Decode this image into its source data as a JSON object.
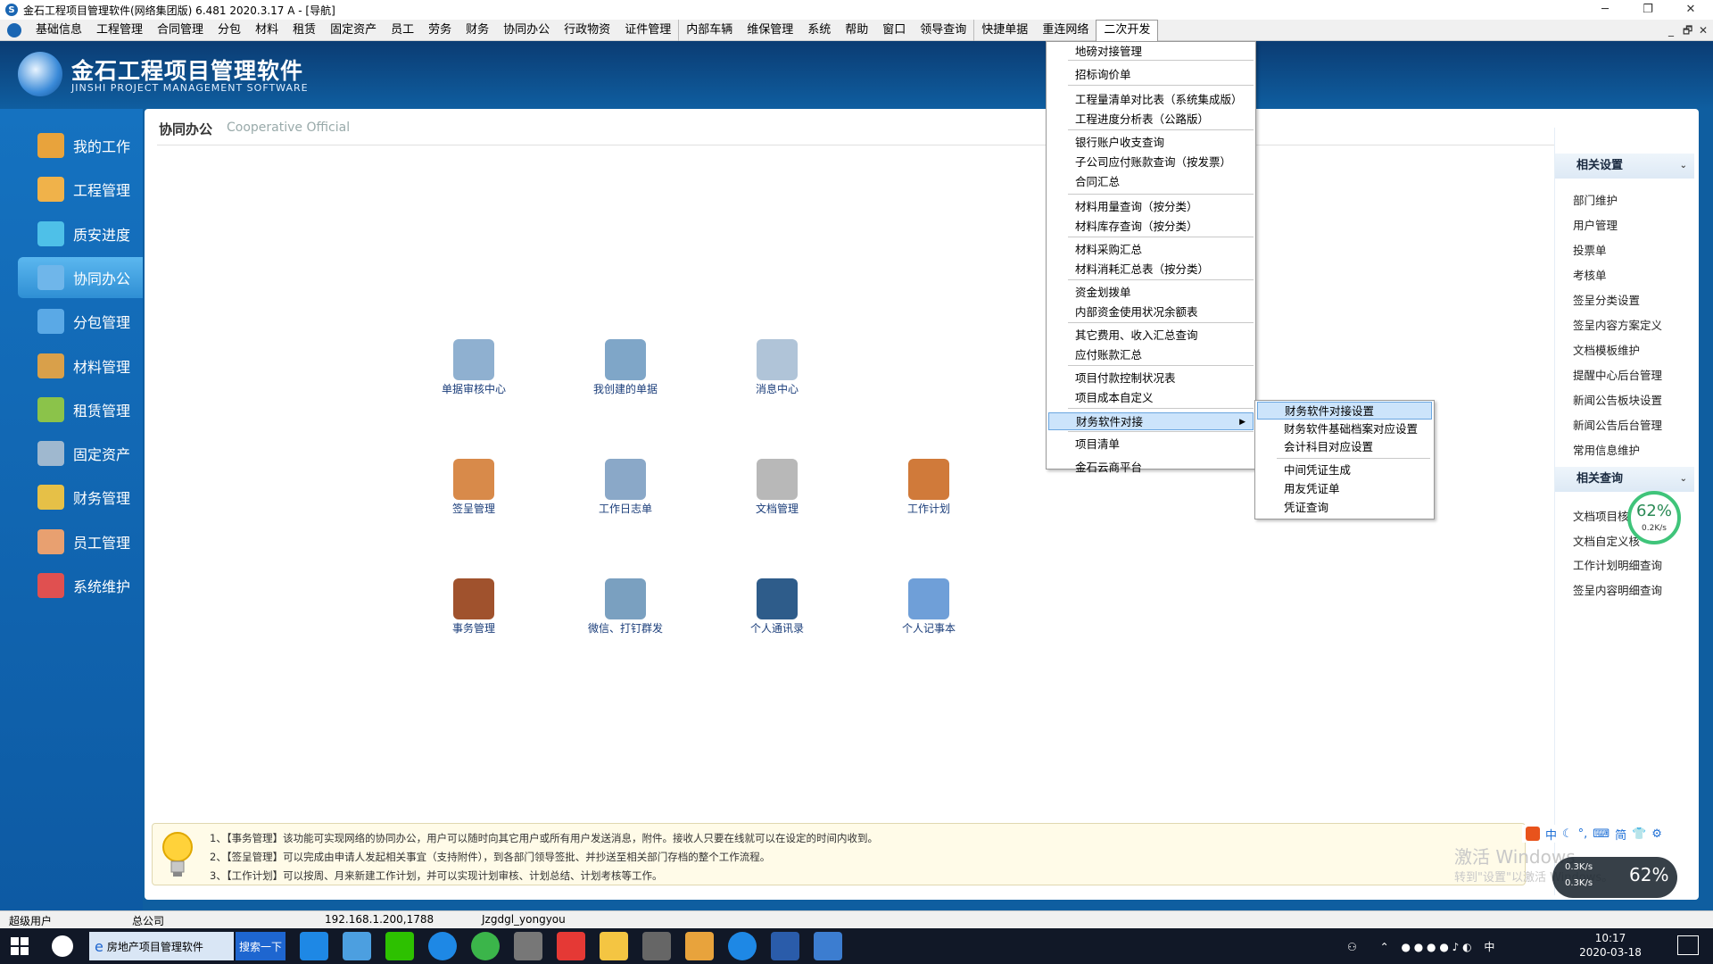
{
  "titlebar": {
    "title": "金石工程项目管理软件(网络集团版) 6.481  2020.3.17 A - [导航]",
    "minimize": "─",
    "restore": "❐",
    "close": "✕"
  },
  "menubar": {
    "items": [
      "基础信息",
      "工程管理",
      "合同管理",
      "分包",
      "材料",
      "租赁",
      "固定资产",
      "员工",
      "劳务",
      "财务",
      "协同办公",
      "行政物资",
      "证件管理",
      "内部车辆",
      "维保管理",
      "系统",
      "帮助",
      "窗口",
      "领导查询",
      "快捷单据",
      "重连网络",
      "二次开发"
    ],
    "mdi_min": "_",
    "mdi_restore": "🗗",
    "mdi_close": "✕"
  },
  "brand": {
    "name_cn": "金石工程项目管理软件",
    "name_en": "JINSHI PROJECT MANAGEMENT SOFTWARE"
  },
  "sidebar": {
    "items": [
      {
        "label": "我的工作",
        "color": "#e8a33c"
      },
      {
        "label": "工程管理",
        "color": "#f0b24a"
      },
      {
        "label": "质安进度",
        "color": "#4ec0e8"
      },
      {
        "label": "协同办公",
        "color": "#6fb6ea"
      },
      {
        "label": "分包管理",
        "color": "#5aa9e6"
      },
      {
        "label": "材料管理",
        "color": "#d9a04a"
      },
      {
        "label": "租赁管理",
        "color": "#8bc34a"
      },
      {
        "label": "固定资产",
        "color": "#9fb8cf"
      },
      {
        "label": "财务管理",
        "color": "#e6c047"
      },
      {
        "label": "员工管理",
        "color": "#e8a070"
      },
      {
        "label": "系统维护",
        "color": "#e05050"
      }
    ]
  },
  "main": {
    "title": "协同办公",
    "subtitle": "Cooperative Official",
    "icons": [
      {
        "label": "单据审核中心",
        "color": "#8fb0d0"
      },
      {
        "label": "我创建的单据",
        "color": "#7fa6c8"
      },
      {
        "label": "消息中心",
        "color": "#b0c4d8"
      },
      {
        "label": "签呈管理",
        "color": "#d88a4a"
      },
      {
        "label": "工作日志单",
        "color": "#8aa8c8"
      },
      {
        "label": "文档管理",
        "color": "#b8b8b8"
      },
      {
        "label": "工作计划",
        "color": "#d07a3a"
      },
      {
        "label": "事务管理",
        "color": "#a0522d"
      },
      {
        "label": "微信、打钉群发",
        "color": "#7aa0c0"
      },
      {
        "label": "个人通讯录",
        "color": "#2e5c8a"
      },
      {
        "label": "个人记事本",
        "color": "#6f9fd8"
      }
    ]
  },
  "right_panel": {
    "settings_title": "相关设置",
    "settings_links": [
      "部门维护",
      "用户管理",
      "投票单",
      "考核单",
      "签呈分类设置",
      "签呈内容方案定义",
      "文档模板维护",
      "提醒中心后台管理",
      "新闻公告板块设置",
      "新闻公告后台管理",
      "常用信息维护"
    ],
    "query_title": "相关查询",
    "query_links": [
      "文档项目核",
      "文档自定义核",
      "工作计划明细查询",
      "签呈内容明细查询"
    ],
    "chevron": "⌄"
  },
  "dropdown": {
    "items": [
      "地磅对接管理",
      "招标询价单",
      "工程量清单对比表（系统集成版）",
      "工程进度分析表（公路版）",
      "银行账户收支查询",
      "子公司应付账款查询（按发票）",
      "合同汇总",
      "材料用量查询（按分类）",
      "材料库存查询（按分类）",
      "材料采购汇总",
      "材料消耗汇总表（按分类）",
      "资金划拨单",
      "内部资金使用状况余额表",
      "其它费用、收入汇总查询",
      "应付账款汇总",
      "项目付款控制状况表",
      "项目成本自定义",
      "财务软件对接",
      "项目清单",
      "金石云商平台"
    ],
    "highlighted": "财务软件对接",
    "arrow": "▶"
  },
  "submenu": {
    "items": [
      "财务软件对接设置",
      "财务软件基础档案对应设置",
      "会计科目对应设置",
      "中间凭证生成",
      "用友凭证单",
      "凭证查询"
    ]
  },
  "info": {
    "line1": "1、【事务管理】该功能可实现网络的协同办公，用户可以随时向其它用户或所有用户发送消息，附件。接收人只要在线就可以在设定的时间内收到。",
    "line2": "2、【签呈管理】可以完成由申请人发起相关事宜（支持附件），到各部门领导签批、并抄送至相关部门存档的整个工作流程。",
    "line3": "3、【工作计划】可以按周、月来新建工作计划，并可以实现计划审核、计划总结、计划考核等工作。"
  },
  "statusbar": {
    "user": "超级用户",
    "company": "总公司",
    "server": "192.168.1.200,1788",
    "db": "Jzgdgl_yongyou"
  },
  "taskbar": {
    "task_label": "房地产项目管理软件",
    "search_label": "搜索一下",
    "time": "10:17",
    "date": "2020-03-18",
    "tray_lang": "中"
  },
  "gauge": {
    "percent": "62%",
    "speed": "0.2K/s"
  },
  "gauge2": {
    "percent": "62%",
    "up": "0.3K/s",
    "down": "0.3K/s"
  },
  "ime": {
    "items": [
      "中",
      "简"
    ]
  },
  "watermark": {
    "line1": "激活 Windows",
    "line2": "转到\"设置\"以激活 Windows。"
  }
}
